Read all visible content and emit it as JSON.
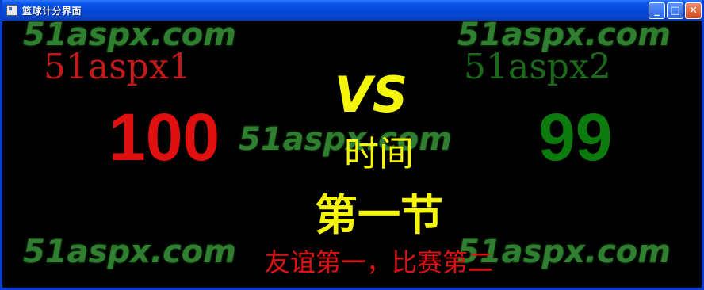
{
  "window": {
    "title": "篮球计分界面",
    "controls": {
      "minimize": "_",
      "maximize": "□",
      "close": "✕"
    }
  },
  "watermark": {
    "text": "51aspx.com"
  },
  "teams": {
    "left": {
      "name": "51aspx1",
      "score": "100",
      "color": "#dd1111"
    },
    "right": {
      "name": "51aspx2",
      "score": "99",
      "color": "#107010"
    }
  },
  "center": {
    "vs": "VS",
    "time_label": "时间",
    "period": "第一节",
    "slogan": "友谊第一，比赛第二"
  },
  "colors": {
    "accent_yellow": "#f5f50a",
    "slogan_red": "#dd1111",
    "watermark_green": "#3ea33e"
  }
}
